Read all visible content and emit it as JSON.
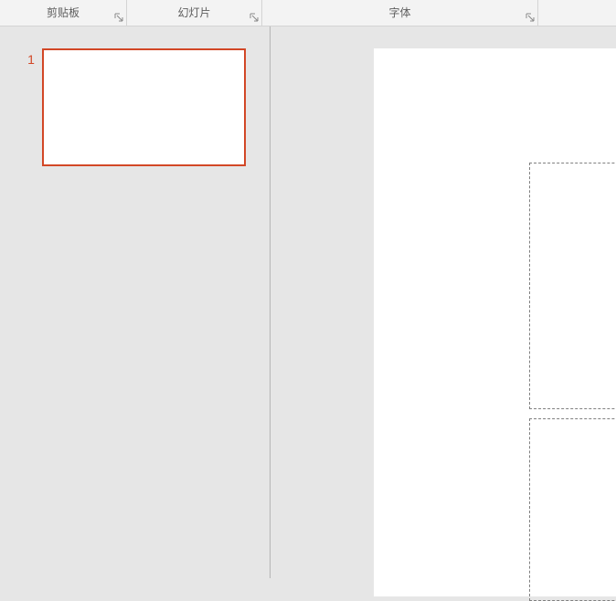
{
  "ribbon": {
    "clipboard_label": "剪贴板",
    "slides_label": "幻灯片",
    "fonts_label": "字体"
  },
  "slides": {
    "items": [
      {
        "number": "1"
      }
    ]
  }
}
